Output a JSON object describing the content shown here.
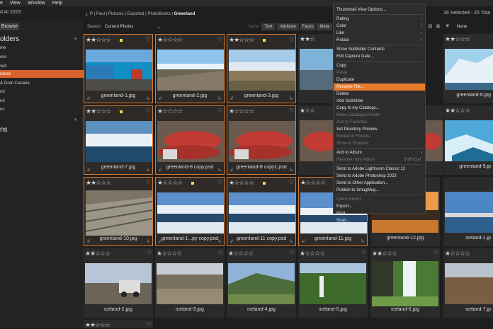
{
  "menubar": {
    "items": [
      "e",
      "View",
      "Window",
      "Help"
    ]
  },
  "app_title": "d AI 2023",
  "selection_count": "16 Selected - 25 Tota",
  "browse_button": "Browse",
  "sidebar": {
    "folders_heading": "olders",
    "items": [
      {
        "label": "me",
        "selected": false
      },
      {
        "label": "oks",
        "selected": false
      },
      {
        "label": "vell",
        "selected": false
      },
      {
        "label": "nland",
        "selected": true
      },
      {
        "label": "& Gran Canaria",
        "selected": false
      },
      {
        "label": "nd",
        "selected": false
      },
      {
        "label": "nd",
        "selected": false
      },
      {
        "label": "es",
        "selected": false
      }
    ],
    "second_heading": "ns"
  },
  "breadcrumb": {
    "items": [
      "P",
      "Paul",
      "Pictures",
      "Exported",
      "PhotoBooks",
      "Greenland"
    ]
  },
  "search": {
    "label": "Search",
    "value": "Current Photos"
  },
  "filter": {
    "none_label": "None",
    "segments": [
      "Text",
      "Attribute",
      "Faces",
      "Meta"
    ],
    "right_label": "None"
  },
  "colors": {
    "accent": "#d8622b",
    "flag": "#f1e43b",
    "selection_border": "#d97a2e"
  },
  "rows": [
    [
      {
        "name": "greenland-1.jpg",
        "stars": "★★☆☆☆",
        "flag": true,
        "selected": true
      },
      {
        "name": "greenland-2.jpg",
        "stars": "★☆☆☆☆",
        "flag": false,
        "selected": true
      },
      {
        "name": "greenland-3.jpg",
        "stars": "★★☆☆☆",
        "flag": true,
        "selected": true
      },
      {
        "name": "",
        "stars": "★★☆",
        "flag": false,
        "selected": false
      },
      {
        "name": "",
        "stars": "",
        "flag": false,
        "selected": false
      },
      {
        "name": "greenland-6.jpg",
        "stars": "★★☆☆☆",
        "flag": false,
        "selected": false
      }
    ],
    [
      {
        "name": "greenland-7.jpg",
        "stars": "★★☆☆☆",
        "flag": true,
        "selected": true
      },
      {
        "name": "greenland-8 copy.psd",
        "stars": "★☆☆☆☆",
        "flag": false,
        "selected": true
      },
      {
        "name": "greenland-8 copy1.psd",
        "stars": "★☆☆☆☆",
        "flag": false,
        "selected": true
      },
      {
        "name": "",
        "stars": "★☆☆",
        "flag": false,
        "selected": false
      },
      {
        "name": "",
        "stars": "",
        "flag": false,
        "selected": false
      },
      {
        "name": "greenland-9.jp",
        "stars": "★★☆☆☆",
        "flag": false,
        "selected": false
      }
    ],
    [
      {
        "name": "greenland-10.jpg",
        "stars": "★★☆☆☆",
        "flag": false,
        "selected": true
      },
      {
        "name": "greenland-1...py copy.psd",
        "stars": "★☆☆☆☆",
        "flag": true,
        "selected": true
      },
      {
        "name": "greenland-11 copy.psd",
        "stars": "★☆☆☆☆",
        "flag": true,
        "selected": true
      },
      {
        "name": "greenland-11.jpg",
        "stars": "★☆☆☆☆",
        "flag": true,
        "selected": true
      },
      {
        "name": "greenland-12.jpg",
        "stars": "",
        "flag": false,
        "selected": false
      },
      {
        "name": "iceland-1.jp",
        "stars": "",
        "flag": false,
        "selected": false
      }
    ],
    [
      {
        "name": "iceland-2.jpg",
        "stars": "★★☆☆☆",
        "flag": false,
        "selected": false
      },
      {
        "name": "iceland-3.jpg",
        "stars": "★☆☆☆☆",
        "flag": false,
        "selected": false
      },
      {
        "name": "iceland-4.jpg",
        "stars": "★☆☆☆☆",
        "flag": false,
        "selected": false
      },
      {
        "name": "iceland-5.jpg",
        "stars": "★☆☆☆☆",
        "flag": false,
        "selected": false
      },
      {
        "name": "iceland-6.jpg",
        "stars": "★★☆☆☆",
        "flag": false,
        "selected": false
      },
      {
        "name": "iceland-7.jp",
        "stars": "★☆☆☆☆",
        "flag": false,
        "selected": false
      }
    ],
    [
      {
        "name": "",
        "stars": "★★☆☆☆",
        "flag": false,
        "selected": false
      }
    ]
  ],
  "context_menu": {
    "items": [
      {
        "label": "Thumbnail View Options...",
        "disabled": false,
        "highlight": false,
        "submenu": false
      },
      {
        "sep": true
      },
      {
        "label": "Rating",
        "disabled": false,
        "highlight": false,
        "submenu": true
      },
      {
        "label": "Color",
        "disabled": false,
        "highlight": false,
        "submenu": true
      },
      {
        "label": "Like",
        "disabled": false,
        "highlight": false,
        "submenu": true
      },
      {
        "label": "Rotate",
        "disabled": false,
        "highlight": false,
        "submenu": true
      },
      {
        "sep": true
      },
      {
        "label": "Show Subfolder Contents",
        "disabled": false,
        "highlight": false,
        "submenu": false
      },
      {
        "label": "Edit Capture Date...",
        "disabled": false,
        "highlight": false,
        "submenu": false
      },
      {
        "sep": true
      },
      {
        "label": "Copy",
        "disabled": false,
        "highlight": false,
        "submenu": false
      },
      {
        "label": "Paste",
        "disabled": true,
        "highlight": false,
        "submenu": false
      },
      {
        "label": "Duplicate",
        "disabled": false,
        "highlight": false,
        "submenu": false
      },
      {
        "label": "Rename File...",
        "disabled": false,
        "highlight": true,
        "submenu": false
      },
      {
        "label": "Delete",
        "disabled": false,
        "highlight": false,
        "submenu": false
      },
      {
        "label": "Add Subfolder",
        "disabled": false,
        "highlight": false,
        "submenu": false
      },
      {
        "label": "Copy to my Catalogs...",
        "disabled": false,
        "highlight": false,
        "submenu": false
      },
      {
        "label": "Make Cataloged Folder",
        "disabled": true,
        "highlight": false,
        "submenu": false
      },
      {
        "label": "Add to Favorites",
        "disabled": true,
        "highlight": false,
        "submenu": false
      },
      {
        "label": "Set Directory Preview",
        "disabled": false,
        "highlight": false,
        "submenu": false
      },
      {
        "label": "Reveal in Folders",
        "disabled": true,
        "highlight": false,
        "submenu": false
      },
      {
        "label": "Show in Explorer",
        "disabled": true,
        "highlight": false,
        "submenu": false
      },
      {
        "sep": true
      },
      {
        "label": "Add to Album",
        "disabled": false,
        "highlight": false,
        "submenu": true
      },
      {
        "label": "Remove from Album",
        "disabled": true,
        "highlight": false,
        "submenu": false,
        "shortcut": "Shift+Del"
      },
      {
        "sep": true
      },
      {
        "label": "Send to Adobe Lightroom Classic 12",
        "disabled": false,
        "highlight": false,
        "submenu": false
      },
      {
        "label": "Send to Adobe Photoshop 2023",
        "disabled": false,
        "highlight": false,
        "submenu": false
      },
      {
        "label": "Send to Other Application...",
        "disabled": false,
        "highlight": false,
        "submenu": false
      },
      {
        "label": "Publish to SmugMug...",
        "disabled": false,
        "highlight": false,
        "submenu": false
      },
      {
        "sep": true
      },
      {
        "label": "Quick Export",
        "disabled": true,
        "highlight": false,
        "submenu": false
      },
      {
        "label": "Export...",
        "disabled": false,
        "highlight": false,
        "submenu": false
      },
      {
        "label": "Print...",
        "disabled": false,
        "highlight": false,
        "submenu": false
      },
      {
        "label": "Scan...",
        "disabled": false,
        "highlight": false,
        "submenu": false
      }
    ]
  }
}
